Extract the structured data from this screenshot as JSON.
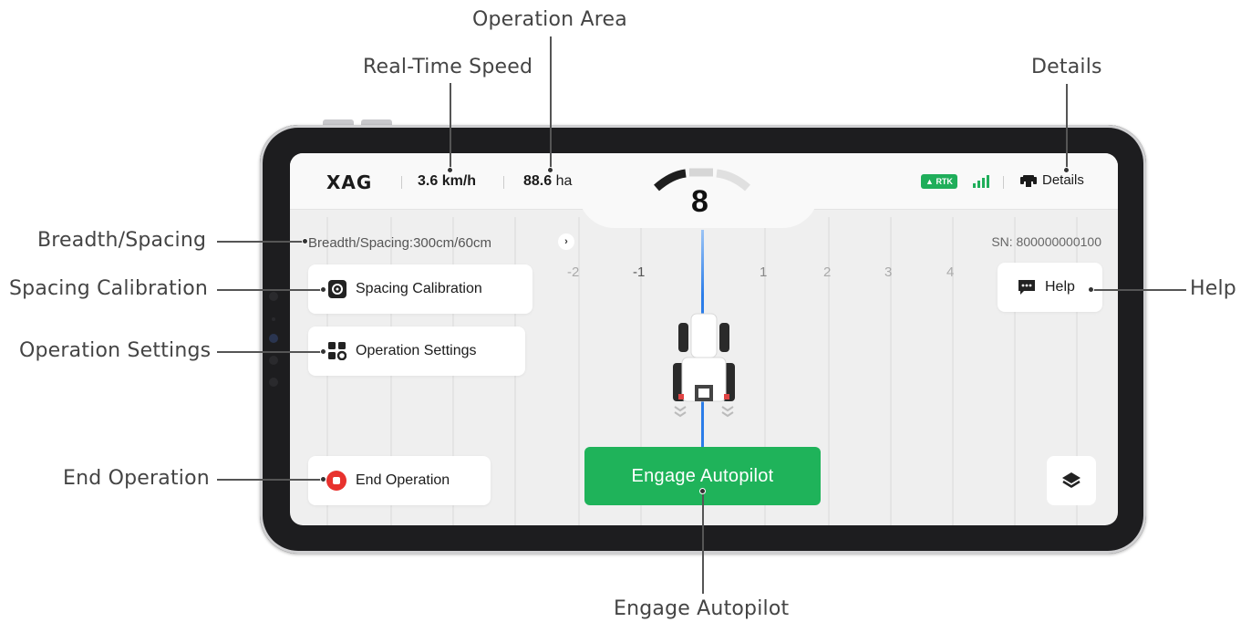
{
  "callouts": {
    "operation_area": "Operation Area",
    "real_time_speed": "Real-Time Speed",
    "details": "Details",
    "breadth_spacing": "Breadth/Spacing",
    "spacing_calibration": "Spacing Calibration",
    "operation_settings": "Operation Settings",
    "end_operation": "End Operation",
    "help": "Help",
    "engage_autopilot": "Engage Autopilot"
  },
  "app": {
    "logo": "XAG",
    "speed": "3.6 km/h",
    "area_value": "88.6",
    "area_unit": "ha",
    "gauge_value": "8",
    "rtk_label": "RTK",
    "details_label": "Details",
    "breadth_text": "Breadth/Spacing:300cm/60cm",
    "sn_text": "SN: 800000000100",
    "lane_numbers": [
      "-2",
      "-1",
      "1",
      "2",
      "3",
      "4"
    ],
    "spacing_calibration_label": "Spacing Calibration",
    "operation_settings_label": "Operation Settings",
    "help_label": "Help",
    "end_operation_label": "End Operation",
    "engage_label": "Engage Autopilot"
  },
  "icons": {
    "spacing": "crosshair-icon",
    "settings": "grid-gear-icon",
    "help": "chat-bubble-icon",
    "end": "stop-circle-icon",
    "layers": "layers-icon",
    "details": "tractor-icon",
    "signal": "signal-bars-icon"
  },
  "colors": {
    "accent_green": "#1fb35a",
    "rtk_green": "#1fae5a",
    "stop_red": "#e8322e",
    "guide_blue": "#2b7de9"
  }
}
